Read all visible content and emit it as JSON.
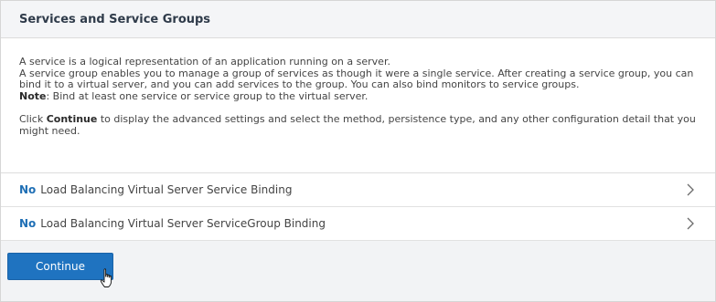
{
  "panel": {
    "title": "Services and Service Groups"
  },
  "description": {
    "line1": "A service is a logical representation of an application running on a server.",
    "line2": "A service group enables you to manage a group of services as though it were a single service. After creating a service group, you can bind it to a virtual server, and you can add services to the group. You can also bind monitors to service groups.",
    "note_label": "Note",
    "note_text": ": Bind at least one service or service group to the virtual server.",
    "click_prefix": "Click ",
    "click_bold": "Continue",
    "click_suffix": " to display the advanced settings and select the method, persistence type, and any other configuration detail that you might need."
  },
  "bindings": [
    {
      "count": "No",
      "label": "Load Balancing Virtual Server Service Binding"
    },
    {
      "count": "No",
      "label": "Load Balancing Virtual Server ServiceGroup Binding"
    }
  ],
  "footer": {
    "continue_label": "Continue"
  },
  "icons": {
    "row_chevron": "chevron-right-icon",
    "cursor": "hand-pointer-icon"
  },
  "colors": {
    "accent": "#1f73c0",
    "count_text": "#1f6fb5"
  }
}
